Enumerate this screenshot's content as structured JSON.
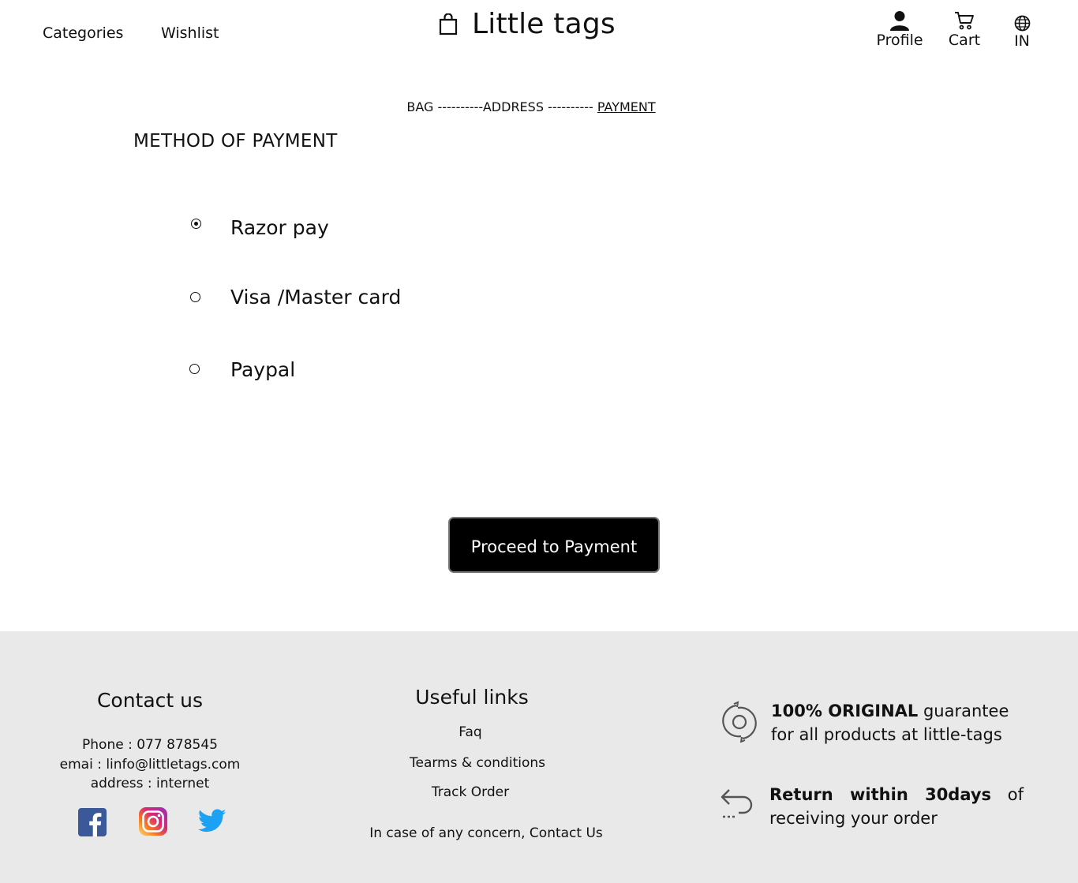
{
  "header": {
    "nav": {
      "categories": "Categories",
      "wishlist": "Wishlist"
    },
    "brand": {
      "title": "Little tags",
      "icon": "shopping-bag-icon"
    },
    "actions": {
      "profile": {
        "label": "Profile",
        "icon": "user-icon"
      },
      "cart": {
        "label": "Cart",
        "icon": "cart-icon"
      },
      "region": {
        "label": "IN",
        "icon": "globe-icon"
      }
    }
  },
  "checkout_steps": {
    "bag": "BAG ----------ADDRESS ---------- ",
    "payment": "PAYMENT"
  },
  "payment": {
    "title": "METHOD OF PAYMENT",
    "options": [
      {
        "label": "Razor pay",
        "selected": true
      },
      {
        "label": "Visa  /Master card",
        "selected": false
      },
      {
        "label": "Paypal",
        "selected": false
      }
    ],
    "proceed_label": "Proceed to Payment"
  },
  "footer": {
    "background": "#e9e9e9",
    "contact": {
      "title": "Contact us",
      "phone": "Phone  : 077 878545",
      "email": "emai : linfo@littletags.com",
      "address": "address : internet",
      "social": [
        {
          "name": "facebook",
          "color": "#3b5998"
        },
        {
          "name": "instagram",
          "color": "#d62976"
        },
        {
          "name": "twitter",
          "color": "#1da1f2"
        }
      ]
    },
    "links": {
      "title": "Useful links",
      "items": [
        "Faq",
        "Tearms & conditions",
        "Track Order"
      ],
      "concern": "In case of any concern, Contact Us"
    },
    "guarantees": [
      {
        "icon": "original-guarantee-icon",
        "bold": "100% ORIGINAL",
        "text": " guarantee for all products at little-tags"
      },
      {
        "icon": "return-icon",
        "bold": "Return within 30days",
        "text": " of receiving your order"
      }
    ]
  }
}
